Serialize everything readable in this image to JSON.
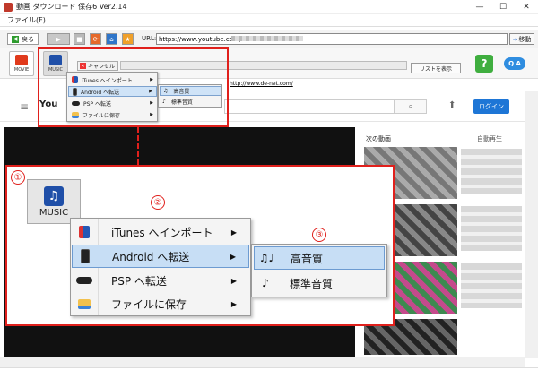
{
  "window": {
    "title": "動画 ダウンロード 保存6 Ver2.14",
    "minimize": "—",
    "maximize": "☐",
    "close": "✕"
  },
  "menubar": {
    "file": "ファイル(F)"
  },
  "navbar": {
    "back_label": "戻る",
    "url_label": "URL:",
    "url_value": "https://www.youtube.com/",
    "go_label": "移動"
  },
  "toolbar": {
    "movie_label": "MOVIE",
    "music_label": "MUSIC",
    "cancel_label": "キャンセル",
    "list_label": "リストを表示",
    "help_label": "?",
    "qa_label": "Q A",
    "site_url": "http://www.de-net.com/"
  },
  "youtube": {
    "logo": "You",
    "menu_glyph": "≡",
    "search_glyph": "⌕",
    "upload_glyph": "⬆",
    "login_label": "ログイン",
    "next_label": "次の動画",
    "autoplay_label": "自動再生"
  },
  "small_menu": {
    "items": [
      {
        "label": "iTunes へインポート",
        "icon": "itunes-icon",
        "has_sub": true
      },
      {
        "label": "Android へ転送",
        "icon": "android-icon",
        "has_sub": true,
        "selected": true
      },
      {
        "label": "PSP へ転送",
        "icon": "psp-icon",
        "has_sub": true
      },
      {
        "label": "ファイルに保存",
        "icon": "folder-icon",
        "has_sub": true
      }
    ],
    "sub_items": [
      {
        "label": "高音質",
        "icon": "music-notes-icon",
        "selected": true
      },
      {
        "label": "標準音質",
        "icon": "music-note-icon"
      }
    ]
  },
  "callout": {
    "badges": [
      "①",
      "②",
      "③"
    ],
    "music_label": "MUSIC",
    "items": [
      {
        "label": "iTunes へインポート",
        "icon": "itunes-icon"
      },
      {
        "label": "Android へ転送",
        "icon": "android-icon",
        "selected": true
      },
      {
        "label": "PSP へ転送",
        "icon": "psp-icon"
      },
      {
        "label": "ファイルに保存",
        "icon": "folder-icon"
      }
    ],
    "sub_items": [
      {
        "label": "高音質",
        "icon": "music-notes-icon",
        "selected": true
      },
      {
        "label": "標準音質",
        "icon": "music-note-icon"
      }
    ]
  },
  "colors": {
    "highlight_red": "#e0201c",
    "selection_blue": "#c7def5",
    "youtube_blue": "#1e76d6",
    "help_green": "#3fae3f"
  }
}
